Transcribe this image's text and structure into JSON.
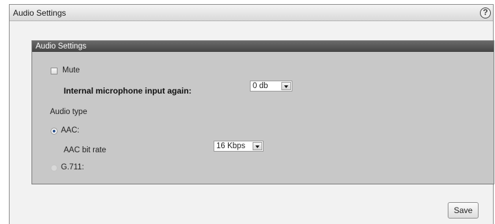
{
  "window": {
    "title": "Audio Settings",
    "help_icon": "?"
  },
  "panel": {
    "header": "Audio Settings",
    "mute": {
      "label": "Mute",
      "checked": false
    },
    "mic_gain": {
      "label": "Internal microphone input again:",
      "value": "0 db"
    },
    "audio_type": {
      "label": "Audio type",
      "options": [
        {
          "label": "AAC:",
          "selected": true
        },
        {
          "label": "G.711:",
          "selected": false
        }
      ],
      "aac_bit_rate": {
        "label": "AAC bit rate",
        "value": "16 Kbps"
      }
    }
  },
  "footer": {
    "save_label": "Save"
  }
}
